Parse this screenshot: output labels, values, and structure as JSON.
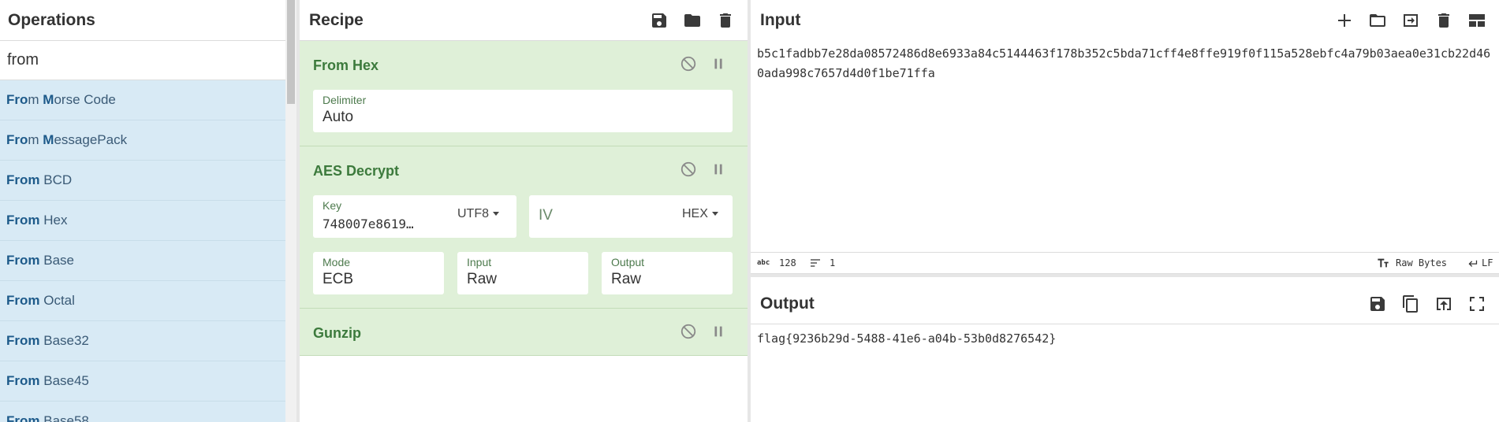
{
  "operations": {
    "title": "Operations",
    "search_value": "from",
    "items": [
      {
        "match": "Fro",
        "match2": "m ",
        "bold2": "M",
        "rest": "orse Code"
      },
      {
        "match": "Fro",
        "match2": "m ",
        "bold2": "M",
        "rest": "essagePack"
      },
      {
        "match": "From",
        "match2": " ",
        "bold2": "",
        "rest": "BCD"
      },
      {
        "match": "From",
        "match2": " ",
        "bold2": "",
        "rest": "Hex"
      },
      {
        "match": "From",
        "match2": " ",
        "bold2": "",
        "rest": "Base"
      },
      {
        "match": "From",
        "match2": " ",
        "bold2": "",
        "rest": "Octal"
      },
      {
        "match": "From",
        "match2": " ",
        "bold2": "",
        "rest": "Base32"
      },
      {
        "match": "From",
        "match2": " ",
        "bold2": "",
        "rest": "Base45"
      },
      {
        "match": "From",
        "match2": " ",
        "bold2": "",
        "rest": "Base58"
      }
    ]
  },
  "recipe": {
    "title": "Recipe",
    "icons": [
      "save-icon",
      "folder-icon",
      "trash-icon"
    ],
    "ingredients": [
      {
        "name": "From Hex",
        "delimiter_label": "Delimiter",
        "delimiter_value": "Auto"
      },
      {
        "name": "AES Decrypt",
        "key_label": "Key",
        "key_value": "748007e8619…",
        "key_encoding": "UTF8",
        "iv_label": "IV",
        "iv_encoding": "HEX",
        "mode_label": "Mode",
        "mode_value": "ECB",
        "input_label": "Input",
        "input_value": "Raw",
        "output_label": "Output",
        "output_value": "Raw"
      },
      {
        "name": "Gunzip"
      }
    ]
  },
  "input": {
    "title": "Input",
    "icons": [
      "plus-icon",
      "folder-icon",
      "import-icon",
      "trash-icon",
      "layout-icon"
    ],
    "text": "b5c1fadbb7e28da08572486d8e6933a84c5144463f178b352c5bda71cff4e8ffe919f0f115a528ebfc4a79b03aea0e31cb22d460ada998c7657d4d0f1be71ffa",
    "status": {
      "length_icon": "abc",
      "length": "128",
      "lines": "1",
      "encoding": "Raw Bytes",
      "eol": "LF"
    }
  },
  "output": {
    "title": "Output",
    "icons": [
      "save-icon",
      "copy-icon",
      "replace-input-icon",
      "maximize-icon"
    ],
    "text": "flag{9236b29d-5488-41e6-a04b-53b0d8276542}"
  },
  "colors": {
    "ingredient_bg": "#dff0d8",
    "ingredient_title": "#3c7a3c",
    "op_item_bg": "#d8eaf5"
  }
}
